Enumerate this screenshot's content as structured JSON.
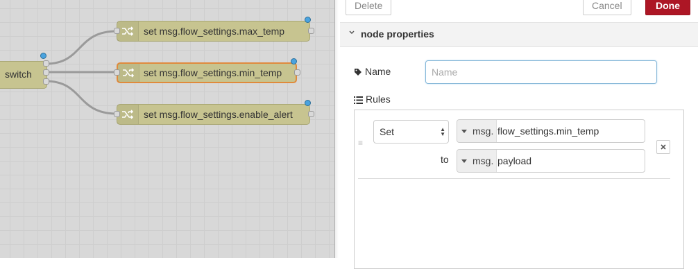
{
  "workspace": {
    "switch_node": {
      "label": "switch"
    },
    "change_nodes": [
      {
        "label": "set msg.flow_settings.max_temp"
      },
      {
        "label": "set msg.flow_settings.min_temp"
      },
      {
        "label": "set msg.flow_settings.enable_alert"
      }
    ]
  },
  "tray": {
    "delete_label": "Delete",
    "cancel_label": "Cancel",
    "done_label": "Done",
    "section_title": "node properties",
    "name_label": "Name",
    "name_value": "",
    "name_placeholder": "Name",
    "rules_label": "Rules",
    "rule": {
      "action": "Set",
      "target_type": "msg.",
      "target_value": "flow_settings.min_temp",
      "to_label": "to",
      "source_type": "msg.",
      "source_value": "payload"
    }
  },
  "colors": {
    "node_fill": "#c7c490",
    "selected_outline": "#e08a3c",
    "done_button": "#ad1625",
    "status_dot": "#4aa3df"
  }
}
